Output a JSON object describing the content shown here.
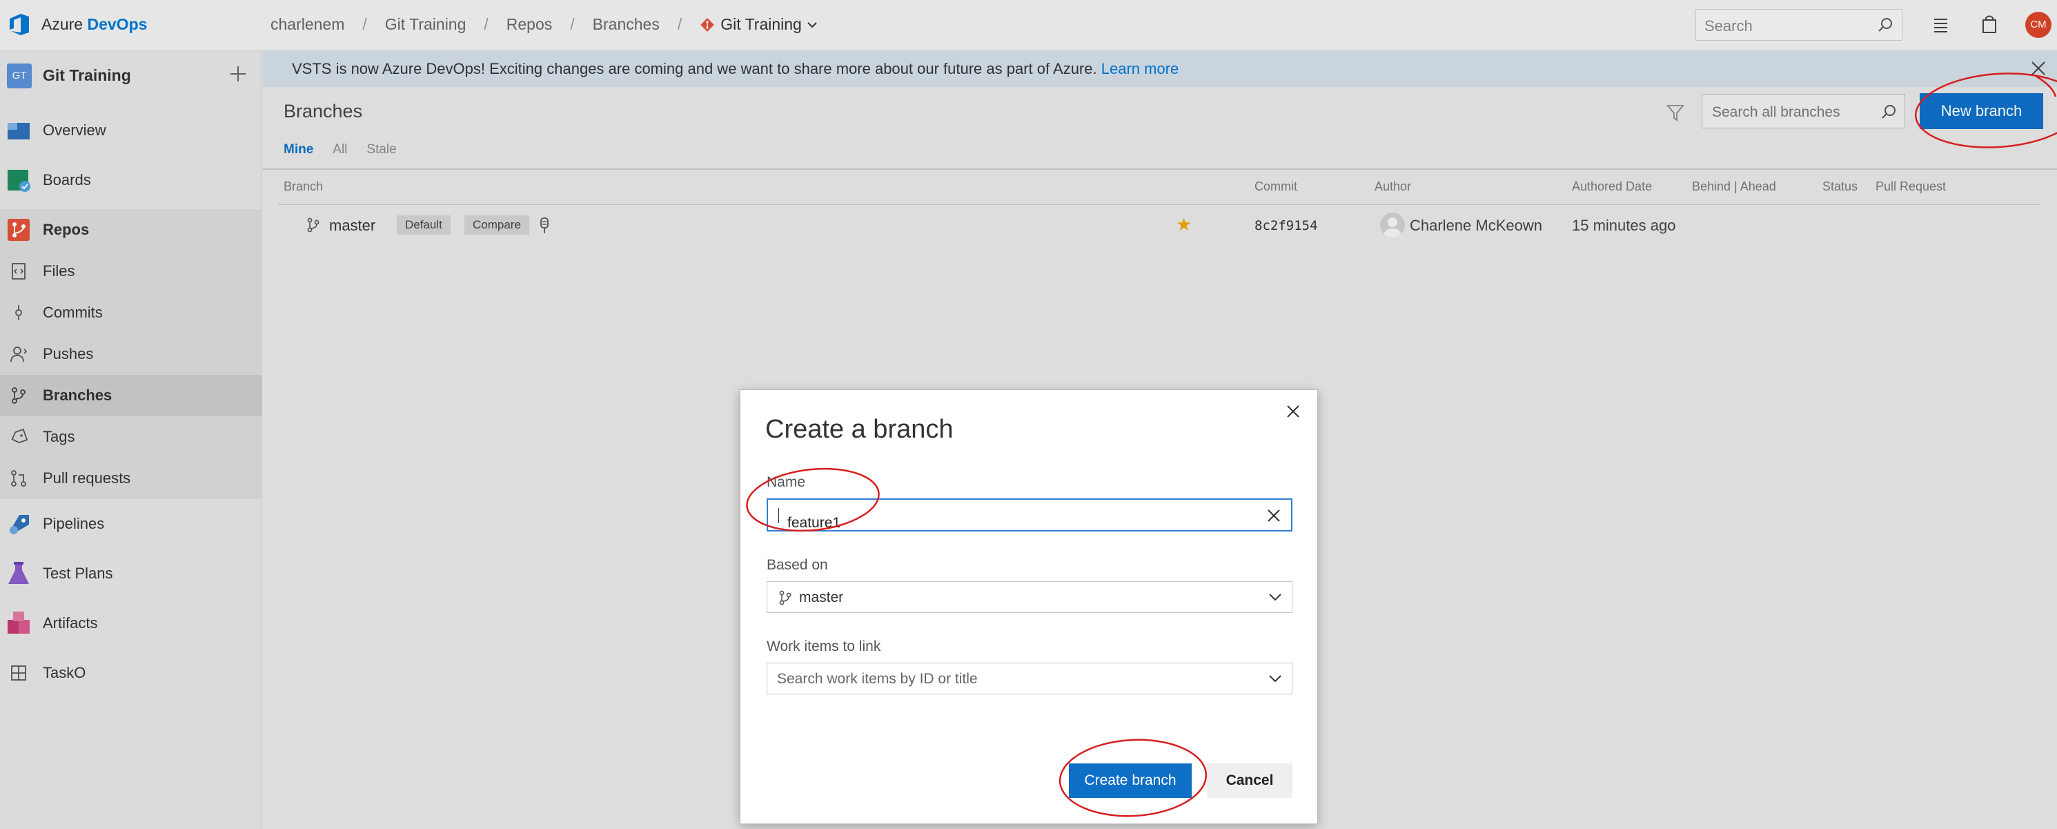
{
  "brand": {
    "prefix": "Azure",
    "name": "DevOps"
  },
  "breadcrumb": {
    "items": [
      "charlenem",
      "Git Training",
      "Repos",
      "Branches"
    ],
    "current": "Git Training",
    "separator": "/"
  },
  "top_search": {
    "placeholder": "Search"
  },
  "user": {
    "initials": "CM"
  },
  "sidebar": {
    "project_badge": "GT",
    "project_name": "Git Training",
    "items": [
      {
        "label": "Overview",
        "icon": "overview-icon"
      },
      {
        "label": "Boards",
        "icon": "boards-icon"
      },
      {
        "label": "Repos",
        "icon": "repos-icon"
      },
      {
        "label": "Files",
        "icon": "files-icon"
      },
      {
        "label": "Commits",
        "icon": "commits-icon"
      },
      {
        "label": "Pushes",
        "icon": "pushes-icon"
      },
      {
        "label": "Branches",
        "icon": "branches-icon"
      },
      {
        "label": "Tags",
        "icon": "tags-icon"
      },
      {
        "label": "Pull requests",
        "icon": "pull-requests-icon"
      },
      {
        "label": "Pipelines",
        "icon": "pipelines-icon"
      },
      {
        "label": "Test Plans",
        "icon": "test-plans-icon"
      },
      {
        "label": "Artifacts",
        "icon": "artifacts-icon"
      },
      {
        "label": "TaskO",
        "icon": "grid-icon"
      }
    ],
    "active": "Branches"
  },
  "banner": {
    "text": "VSTS is now Azure DevOps! Exciting changes are coming and we want to share more about our future as part of Azure.",
    "link": "Learn more"
  },
  "page": {
    "title": "Branches",
    "search_placeholder": "Search all branches",
    "new_branch_label": "New branch",
    "tabs": [
      {
        "label": "Mine",
        "active": true
      },
      {
        "label": "All",
        "active": false
      },
      {
        "label": "Stale",
        "active": false
      }
    ],
    "columns": {
      "branch": "Branch",
      "commit": "Commit",
      "author": "Author",
      "authored_date": "Authored Date",
      "behind_ahead": "Behind | Ahead",
      "status": "Status",
      "pull_request": "Pull Request"
    },
    "rows": [
      {
        "name": "master",
        "default_label": "Default",
        "compare_label": "Compare",
        "favorite": true,
        "commit": "8c2f9154",
        "author": "Charlene McKeown",
        "date": "15 minutes ago"
      }
    ]
  },
  "dialog": {
    "title": "Create a branch",
    "name_label": "Name",
    "name_value": "feature1",
    "based_on_label": "Based on",
    "based_on_value": "master",
    "work_items_label": "Work items to link",
    "work_items_placeholder": "Search work items by ID or title",
    "create_label": "Create branch",
    "cancel_label": "Cancel"
  },
  "colors": {
    "accent": "#0e6fc6",
    "annotation": "#d81e1e",
    "favorite_star": "#e8a800"
  }
}
